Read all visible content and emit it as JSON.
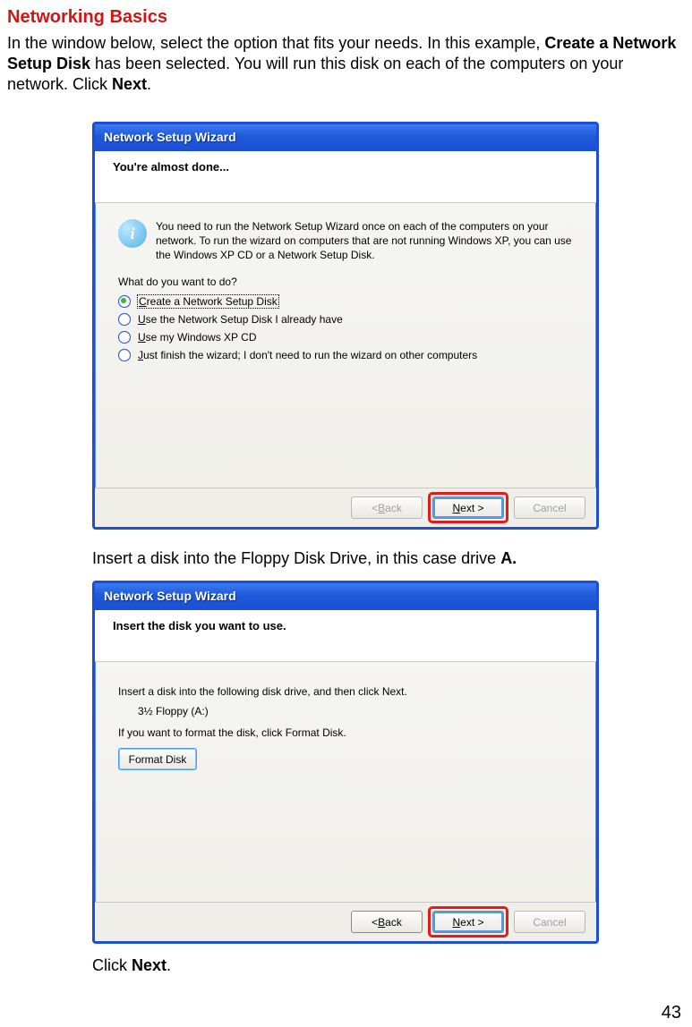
{
  "page": {
    "title": "Networking Basics",
    "intro_parts": {
      "pre": "In the window below, select the option that fits your needs. In this example, ",
      "bold1": "Create a Network Setup Disk",
      "mid": " has been selected.  You will run this disk on each of the computers on your network. Click ",
      "bold2": "Next",
      "end": "."
    },
    "page_number": "43"
  },
  "wizard1": {
    "titlebar": "Network Setup Wizard",
    "header": "You're almost done...",
    "info_text": "You need to run the Network Setup Wizard once on each of the computers on your network. To run the wizard on computers that are not running Windows XP, you can use the Windows XP CD or a Network Setup Disk.",
    "question": "What do you want to do?",
    "options": {
      "opt1_pre": "C",
      "opt1_rest": "reate a Network Setup Disk",
      "opt2_pre": "U",
      "opt2_rest": "se the Network Setup Disk I already have",
      "opt3_pre": "U",
      "opt3_rest": "se my Windows XP CD",
      "opt4_pre": "J",
      "opt4_rest": "ust finish the wizard; I don't need to run the wizard on other computers"
    },
    "buttons": {
      "back_pre": "< ",
      "back_u": "B",
      "back_rest": "ack",
      "next_u": "N",
      "next_rest": "ext >",
      "cancel": "Cancel"
    }
  },
  "midtext": {
    "pre": "Insert a disk into the Floppy Disk Drive, in this case drive ",
    "bold": "A."
  },
  "wizard2": {
    "titlebar": "Network Setup Wizard",
    "header": "Insert the disk you want to use.",
    "line1": "Insert a disk into the following disk drive, and then click Next.",
    "drive": "3½ Floppy (A:)",
    "line2": "If you want to format the disk, click Format Disk.",
    "format_u": "F",
    "format_rest": "ormat Disk",
    "buttons": {
      "back_pre": "< ",
      "back_u": "B",
      "back_rest": "ack",
      "next_u": "N",
      "next_rest": "ext >",
      "cancel": "Cancel"
    }
  },
  "clicknext": {
    "pre": "Click ",
    "bold": "Next",
    "end": "."
  }
}
